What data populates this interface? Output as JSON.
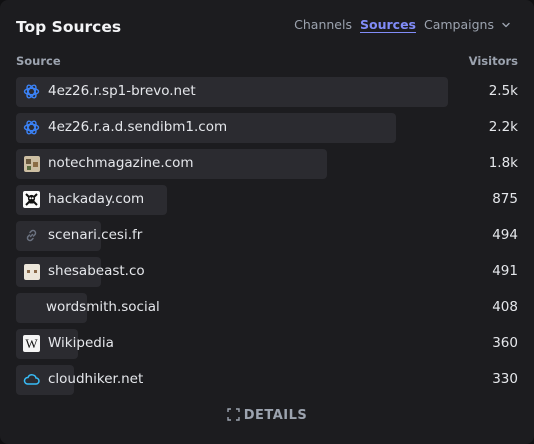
{
  "panel": {
    "title": "Top Sources",
    "tabs": [
      "Channels",
      "Sources",
      "Campaigns"
    ],
    "active_tab": "Sources",
    "col_source": "Source",
    "col_visitors": "Visitors",
    "details_label": "DETAILS"
  },
  "colors": {
    "bar": "#2b2b30",
    "accent": "#818cf8",
    "text": "#e5e7eb",
    "muted": "#9ca3af"
  },
  "rows": [
    {
      "name": "4ez26.r.sp1-brevo.net",
      "visitors": "2.5k",
      "count": 2500,
      "icon": "openai-swirl-icon"
    },
    {
      "name": "4ez26.r.a.d.sendibm1.com",
      "visitors": "2.2k",
      "count": 2200,
      "icon": "openai-swirl-icon"
    },
    {
      "name": "notechmagazine.com",
      "visitors": "1.8k",
      "count": 1800,
      "icon": "favicon-image-icon"
    },
    {
      "name": "hackaday.com",
      "visitors": "875",
      "count": 875,
      "icon": "skull-crossbones-icon"
    },
    {
      "name": "scenari.cesi.fr",
      "visitors": "494",
      "count": 494,
      "icon": "link-icon"
    },
    {
      "name": "shesabeast.co",
      "visitors": "491",
      "count": 491,
      "icon": "favicon-image-icon"
    },
    {
      "name": "wordsmith.social",
      "visitors": "408",
      "count": 408,
      "icon": "none"
    },
    {
      "name": "Wikipedia",
      "visitors": "360",
      "count": 360,
      "icon": "wikipedia-w-icon"
    },
    {
      "name": "cloudhiker.net",
      "visitors": "330",
      "count": 330,
      "icon": "cloud-icon"
    }
  ]
}
